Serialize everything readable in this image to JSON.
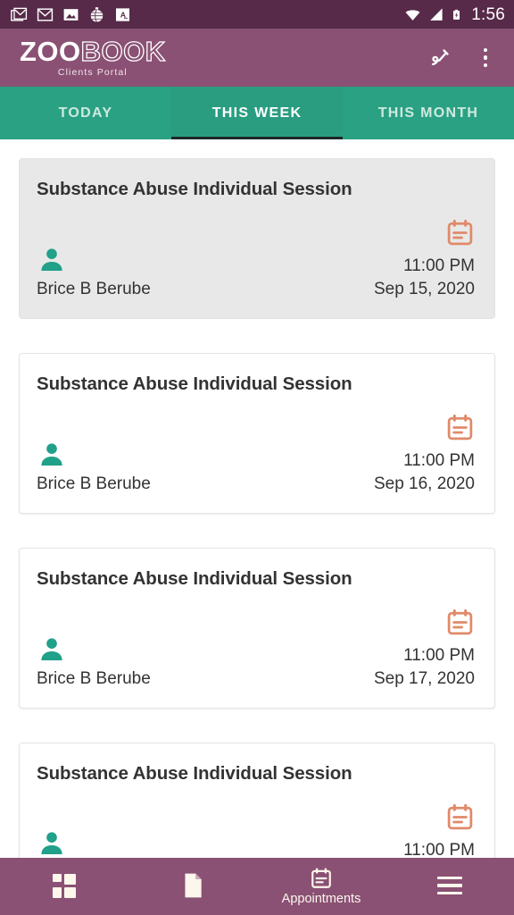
{
  "status_bar": {
    "time": "1:56",
    "left_icons": [
      "gmail-stack-icon",
      "gmail-icon",
      "photo-icon",
      "globe-icon",
      "translate-icon"
    ],
    "right_icons": [
      "wifi-icon",
      "signal-icon",
      "battery-charging-icon"
    ],
    "background": "#562a48"
  },
  "app_bar": {
    "logo_solid": "ZOO",
    "logo_outline": "BOOK",
    "subtitle": "Clients Portal",
    "actions": [
      {
        "name": "signature-edit-icon",
        "label": "Sign"
      },
      {
        "name": "overflow-menu-icon",
        "label": "More options"
      }
    ],
    "background": "#8a5174"
  },
  "tabs": {
    "background": "#2aa183",
    "active_index": 1,
    "items": [
      {
        "label": "TODAY",
        "active": false
      },
      {
        "label": "THIS WEEK",
        "active": true
      },
      {
        "label": "THIS MONTH",
        "active": false
      }
    ]
  },
  "appointments": [
    {
      "title": "Substance Abuse Individual Session",
      "client": "Brice B Berube",
      "time": "11:00 PM",
      "date": "Sep 15, 2020",
      "selected": true
    },
    {
      "title": "Substance Abuse Individual Session",
      "client": "Brice B Berube",
      "time": "11:00 PM",
      "date": "Sep 16, 2020",
      "selected": false
    },
    {
      "title": "Substance Abuse Individual Session",
      "client": "Brice B Berube",
      "time": "11:00 PM",
      "date": "Sep 17, 2020",
      "selected": false
    },
    {
      "title": "Substance Abuse Individual Session",
      "client": "",
      "time": "11:00 PM",
      "date": "",
      "selected": false
    }
  ],
  "bottom_nav": {
    "background": "#8a5174",
    "items": [
      {
        "icon": "dashboard-grid-icon",
        "label": "",
        "active": false
      },
      {
        "icon": "document-icon",
        "label": "",
        "active": false
      },
      {
        "icon": "calendar-icon",
        "label": "Appointments",
        "active": true
      },
      {
        "icon": "hamburger-menu-icon",
        "label": "",
        "active": false
      }
    ]
  },
  "colors": {
    "accent_purple": "#8a5174",
    "status_purple": "#562a48",
    "teal": "#2aa183",
    "person_icon": "#21a08a",
    "calendar_icon": "#e08a6a",
    "selected_card": "#e8e8e8"
  }
}
